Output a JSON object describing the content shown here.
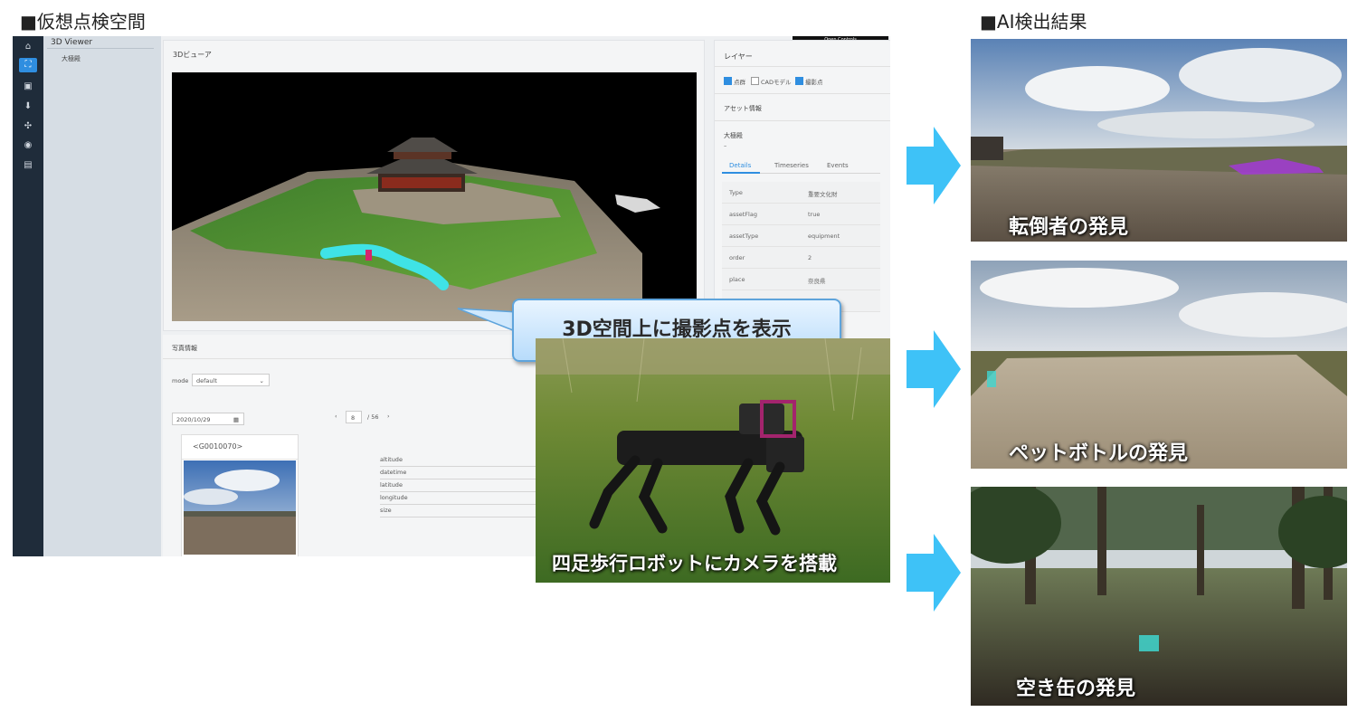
{
  "sections": {
    "virtual_title": "■仮想点検空間",
    "ai_title": "■AI検出結果"
  },
  "viewer_app": {
    "tree_header": "3D Viewer",
    "tree_item": "大極殿",
    "viewer_title": "3Dビューア",
    "open_controls": "Open Controls",
    "layer_title": "レイヤー",
    "layers": [
      {
        "label": "点群",
        "checked": true
      },
      {
        "label": "CADモデル",
        "checked": false
      },
      {
        "label": "撮影点",
        "checked": true
      }
    ],
    "asset_title": "アセット情報",
    "asset_name": "大極殿",
    "asset_sub": "–",
    "tabs": [
      "Details",
      "Timeseries",
      "Events"
    ],
    "details": [
      {
        "key": "Type",
        "value": "重要文化財"
      },
      {
        "key": "assetFlag",
        "value": "true"
      },
      {
        "key": "assetType",
        "value": "equipment"
      },
      {
        "key": "order",
        "value": "2"
      },
      {
        "key": "place",
        "value": "奈良県"
      }
    ],
    "photo_title": "写真情報",
    "mode_label": "mode",
    "mode_value": "default",
    "date_value": "2020/10/29",
    "page_current": "8",
    "page_total": "/ 56",
    "page_prev": "‹",
    "page_next": "›",
    "photo_name": "<G0010070>",
    "meta_fields": [
      "altitude",
      "datetime",
      "latitude",
      "longitude",
      "size"
    ]
  },
  "callout": "3D空間上に撮影点を表示",
  "robot_caption": "四足歩行ロボットにカメラを搭載",
  "results": [
    {
      "caption": "転倒者の発見"
    },
    {
      "caption": "ペットボトルの発見"
    },
    {
      "caption": "空き缶の発見"
    }
  ],
  "colors": {
    "arrow": "#3ec2f7",
    "accent": "#2f8ee0",
    "path_marker": "#3fe3e6",
    "detection": "#a23ad6"
  }
}
